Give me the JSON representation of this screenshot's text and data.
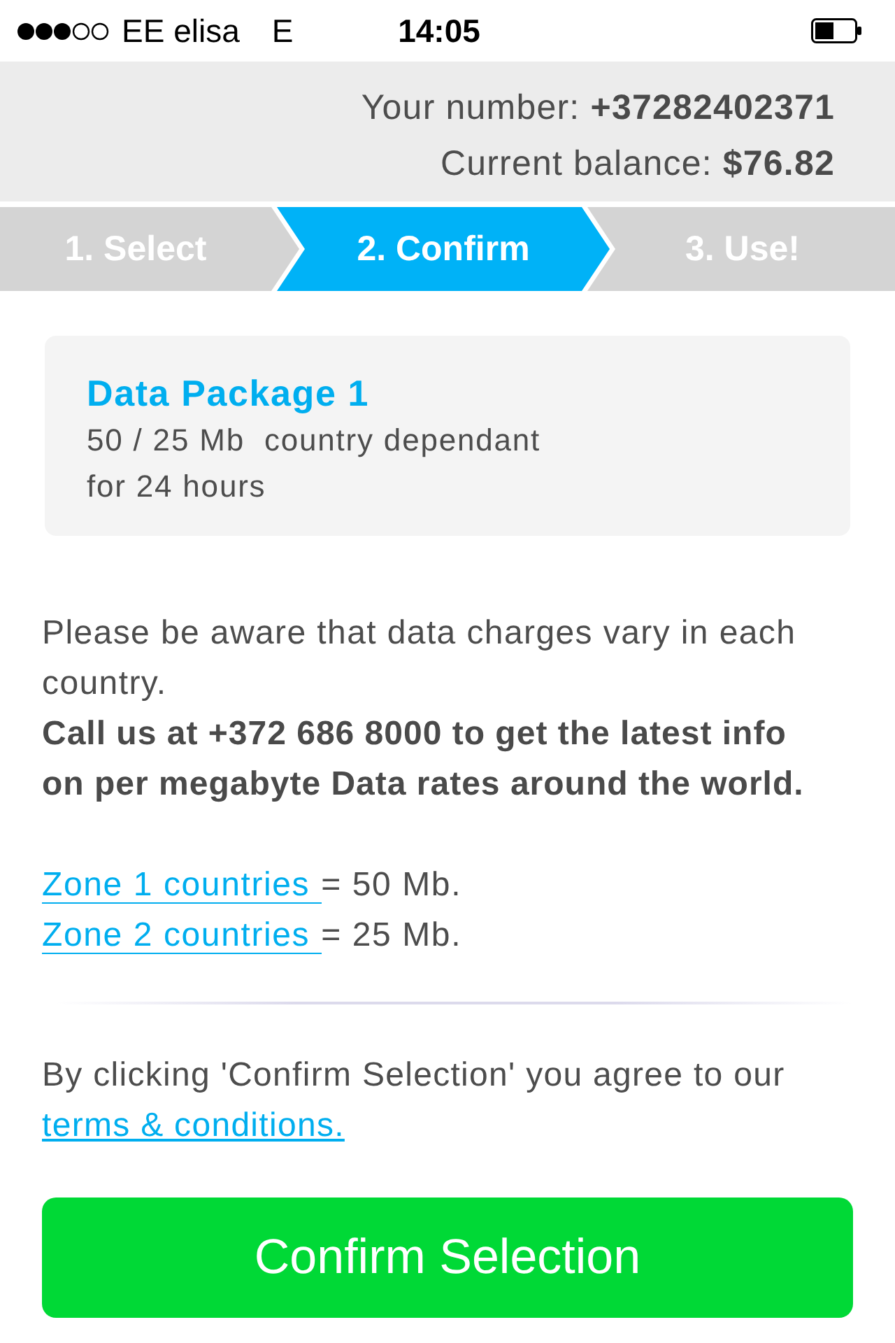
{
  "status_bar": {
    "carrier": "EE elisa",
    "network": "E",
    "time": "14:05"
  },
  "account": {
    "number_line": "Your number: **+37282402371**",
    "balance_line": "Current balance: **$76.82**"
  },
  "steps": [
    {
      "label": "1. Select",
      "selected": false
    },
    {
      "label": "2. Confirm",
      "selected": true
    },
    {
      "label": "3. Use!",
      "selected": false
    }
  ],
  "package": {
    "title": "Data Package 1",
    "details": [
      "50 / 25 Mb  country dependant",
      "for 24 hours"
    ]
  },
  "notice": {
    "text": "Please be aware that data charges vary in each country.",
    "call_us": "Call us at +372 686 8000 to get the latest info on per megabyte Data rates around the world."
  },
  "zones": [
    {
      "link": "Zone 1 countries",
      "text": "= 50 Mb."
    },
    {
      "link": "Zone 2 countries",
      "text": "= 25 Mb."
    }
  ],
  "terms": {
    "text": "By clicking 'Confirm Selection' you agree to our",
    "link": "terms & conditions."
  },
  "confirm_button": "Confirm Selection"
}
